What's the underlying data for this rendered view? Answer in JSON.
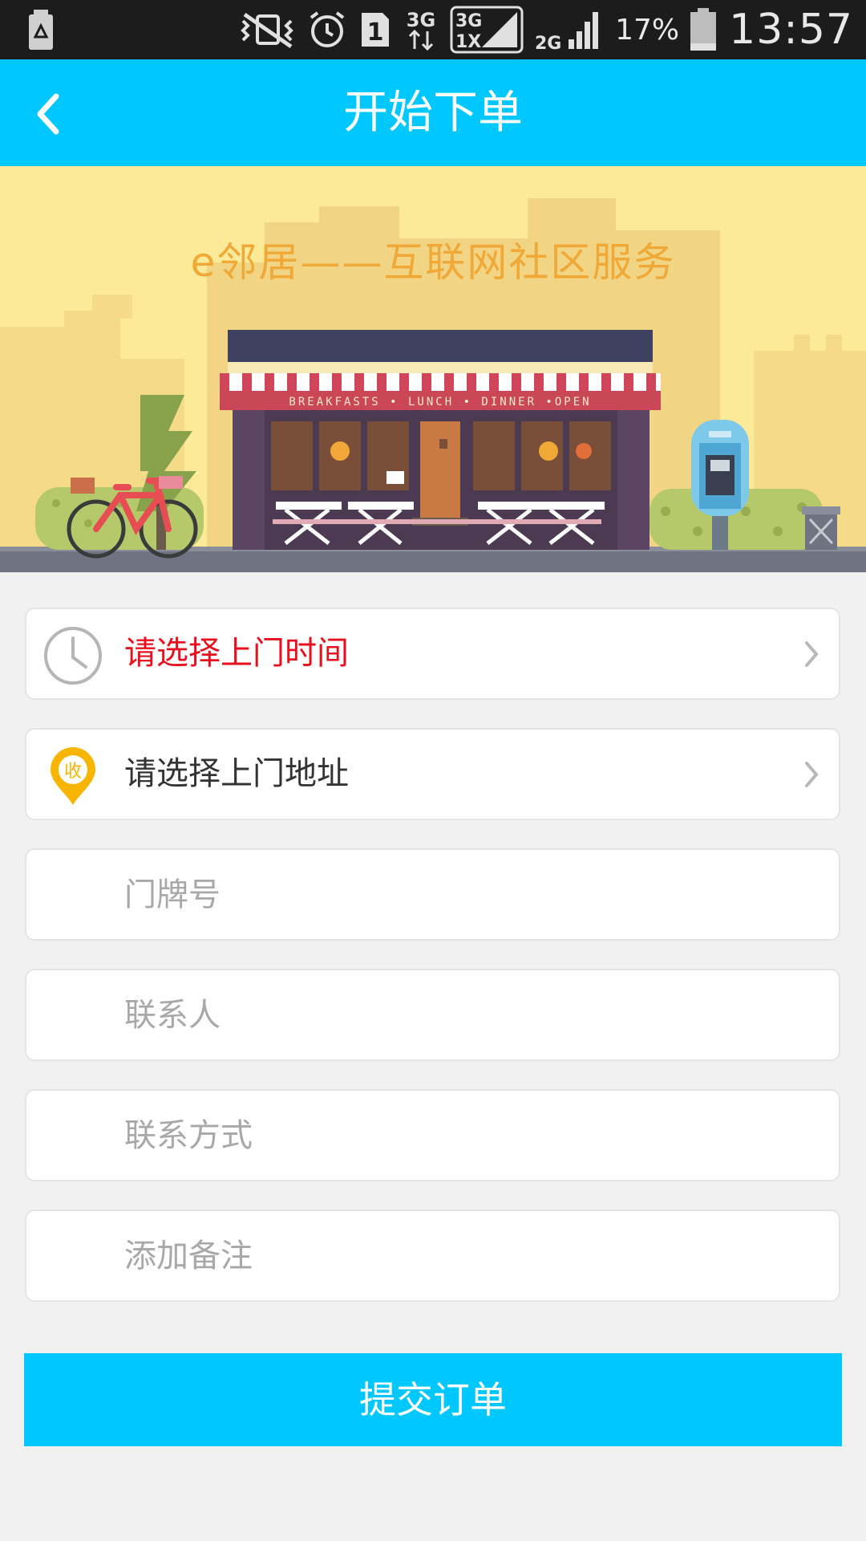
{
  "status_bar": {
    "battery_percent": "17%",
    "time": "13:57",
    "sim_slot": "1",
    "network_1": "3G",
    "network_2_top": "3G",
    "network_2_bottom": "1X",
    "network_3": "2G"
  },
  "header": {
    "title": "开始下单"
  },
  "banner": {
    "slogan": "e邻居——互联网社区服务",
    "awning_text": "BREAKFASTS • LUNCH • DINNER •OPEN",
    "pin_badge": "收"
  },
  "form": {
    "time_label": "请选择上门时间",
    "address_label": "请选择上门地址",
    "door_number_placeholder": "门牌号",
    "contact_placeholder": "联系人",
    "phone_placeholder": "联系方式",
    "note_placeholder": "添加备注"
  },
  "submit": {
    "label": "提交订单"
  },
  "colors": {
    "accent": "#00c8ff",
    "warning_text": "#e8101c",
    "pin": "#f7b500"
  }
}
